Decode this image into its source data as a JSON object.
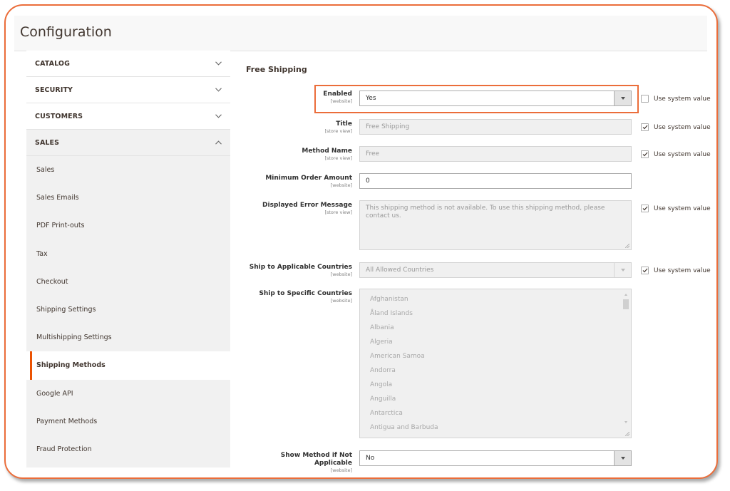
{
  "header": {
    "title": "Configuration"
  },
  "sidebar": {
    "groups": [
      {
        "label": "CATALOG",
        "state": "collapsed"
      },
      {
        "label": "SECURITY",
        "state": "collapsed"
      },
      {
        "label": "CUSTOMERS",
        "state": "collapsed"
      },
      {
        "label": "SALES",
        "state": "expanded"
      }
    ],
    "sales_items": [
      {
        "label": "Sales"
      },
      {
        "label": "Sales Emails"
      },
      {
        "label": "PDF Print-outs"
      },
      {
        "label": "Tax"
      },
      {
        "label": "Checkout"
      },
      {
        "label": "Shipping Settings"
      },
      {
        "label": "Multishipping Settings"
      },
      {
        "label": "Shipping Methods",
        "active": true
      },
      {
        "label": "Google API"
      },
      {
        "label": "Payment Methods"
      },
      {
        "label": "Fraud Protection"
      }
    ]
  },
  "section": {
    "title": "Free Shipping",
    "use_system_label": "Use system value",
    "fields": {
      "enabled": {
        "label": "Enabled",
        "scope": "[website]",
        "value": "Yes",
        "use_system": false
      },
      "title": {
        "label": "Title",
        "scope": "[store view]",
        "value": "Free Shipping",
        "use_system": true
      },
      "method_name": {
        "label": "Method Name",
        "scope": "[store view]",
        "value": "Free",
        "use_system": true
      },
      "min_order": {
        "label": "Minimum Order Amount",
        "scope": "[website]",
        "value": "0"
      },
      "error_msg": {
        "label": "Displayed Error Message",
        "scope": "[store view]",
        "value": "This shipping method is not available. To use this shipping method, please contact us.",
        "use_system": true
      },
      "applicable_countries": {
        "label": "Ship to Applicable Countries",
        "scope": "[website]",
        "value": "All Allowed Countries",
        "use_system": true
      },
      "specific_countries": {
        "label": "Ship to Specific Countries",
        "scope": "[website]",
        "options": [
          "Afghanistan",
          "Åland Islands",
          "Albania",
          "Algeria",
          "American Samoa",
          "Andorra",
          "Angola",
          "Anguilla",
          "Antarctica",
          "Antigua and Barbuda"
        ]
      },
      "show_method": {
        "label": "Show Method if Not Applicable",
        "scope": "[website]",
        "value": "No"
      }
    }
  },
  "colors": {
    "accent": "#eb6d3a",
    "active_marker": "#eb5202"
  }
}
